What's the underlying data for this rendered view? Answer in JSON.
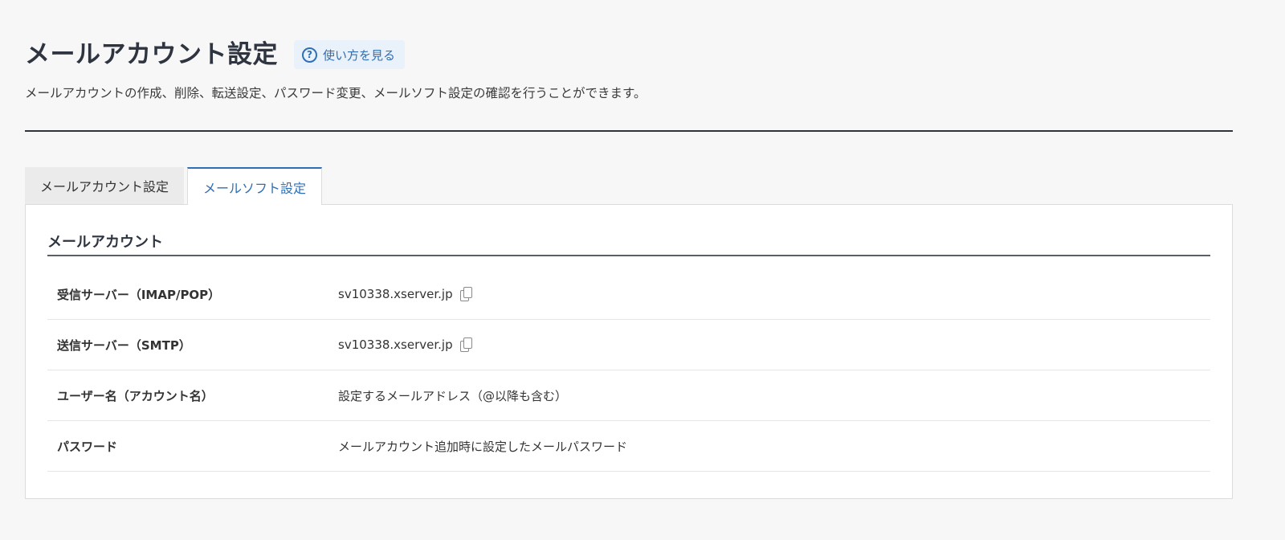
{
  "header": {
    "title": "メールアカウント設定",
    "help_label": "使い方を見る",
    "help_icon": "question-circle-icon",
    "description": "メールアカウントの作成、削除、転送設定、パスワード変更、メールソフト設定の確認を行うことができます。"
  },
  "tabs": [
    {
      "label": "メールアカウント設定",
      "active": false
    },
    {
      "label": "メールソフト設定",
      "active": true
    }
  ],
  "section": {
    "title": "メールアカウント",
    "rows": [
      {
        "label": "受信サーバー（IMAP/POP）",
        "value": "sv10338.xserver.jp",
        "copy": true
      },
      {
        "label": "送信サーバー（SMTP）",
        "value": "sv10338.xserver.jp",
        "copy": true
      },
      {
        "label": "ユーザー名（アカウント名）",
        "value": "設定するメールアドレス（@以降も含む）",
        "copy": false
      },
      {
        "label": "パスワード",
        "value": "メールアカウント追加時に設定したメールパスワード",
        "copy": false
      }
    ]
  },
  "colors": {
    "accent": "#2f6fb5",
    "title": "#2f3540",
    "background": "#f7f7f7"
  }
}
